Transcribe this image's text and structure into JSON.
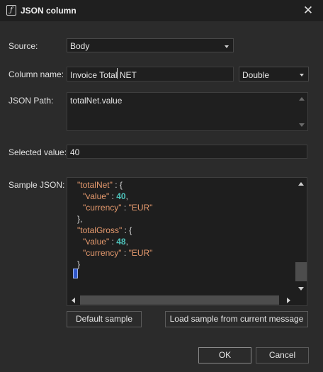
{
  "window": {
    "icon_glyph": "ƒ",
    "title": "JSON column"
  },
  "labels": {
    "source": "Source:",
    "column_name": "Column name:",
    "json_path": "JSON Path:",
    "selected_value": "Selected value:",
    "sample_json": "Sample JSON:"
  },
  "source": {
    "value": "Body"
  },
  "column": {
    "name": "Invoice Total NET",
    "type": "Double"
  },
  "json_path": {
    "value": "totalNet.value"
  },
  "selected_value": {
    "value": "40"
  },
  "sample_json": {
    "lines": [
      {
        "key": "\"totalNet\"",
        "rest": " : {"
      },
      {
        "key": "\"value\"",
        "sep": " : ",
        "num": "40",
        "end": ","
      },
      {
        "key": "\"currency\"",
        "sep": " : ",
        "str": "\"EUR\""
      },
      {
        "punct": "},"
      },
      {
        "key": "\"totalGross\"",
        "rest": " : {"
      },
      {
        "key": "\"value\"",
        "sep": " : ",
        "num": "48",
        "end": ","
      },
      {
        "key": "\"currency\"",
        "sep": " : ",
        "str": "\"EUR\""
      },
      {
        "punct": "}"
      }
    ]
  },
  "buttons": {
    "default_sample": "Default sample",
    "load_sample": "Load sample from current message",
    "ok": "OK",
    "cancel": "Cancel"
  },
  "colors": {
    "background": "#2b2b2b",
    "titlebar": "#1f1f1f",
    "field": "#1f1f1f",
    "json_key": "#e69a6e",
    "json_number": "#4ec4bc",
    "selection": "#2f56c8"
  }
}
